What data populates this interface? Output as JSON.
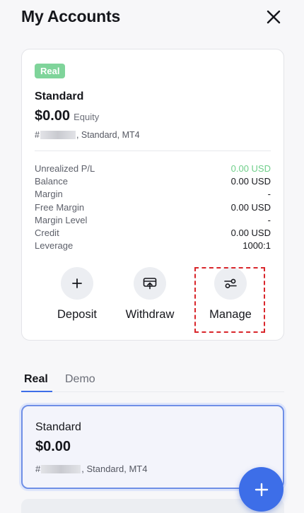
{
  "header": {
    "title": "My Accounts",
    "close_icon": "close-icon"
  },
  "account": {
    "badge": "Real",
    "name": "Standard",
    "equity_value": "$0.00",
    "equity_label": "Equity",
    "meta_prefix": "#",
    "meta_suffix": ", Standard, MT4",
    "stats": [
      {
        "label": "Unrealized P/L",
        "value": "0.00 USD",
        "positive": true
      },
      {
        "label": "Balance",
        "value": "0.00 USD"
      },
      {
        "label": "Margin",
        "value": "-"
      },
      {
        "label": "Free Margin",
        "value": "0.00 USD"
      },
      {
        "label": "Margin Level",
        "value": "-"
      },
      {
        "label": "Credit",
        "value": "0.00 USD"
      },
      {
        "label": "Leverage",
        "value": "1000:1"
      }
    ],
    "actions": [
      {
        "label": "Deposit",
        "icon": "plus-icon"
      },
      {
        "label": "Withdraw",
        "icon": "withdraw-icon"
      },
      {
        "label": "Manage",
        "icon": "sliders-icon"
      }
    ]
  },
  "tabs": [
    {
      "label": "Real",
      "active": true
    },
    {
      "label": "Demo",
      "active": false
    }
  ],
  "account_list": [
    {
      "name": "Standard",
      "amount": "$0.00",
      "meta_prefix": "#",
      "meta_suffix": ", Standard, MT4"
    }
  ],
  "fab_icon": "plus-icon",
  "colors": {
    "accent": "#3d6ee8",
    "badge": "#7fd49a",
    "positive": "#6fcf8a",
    "highlight": "#d9262b"
  }
}
